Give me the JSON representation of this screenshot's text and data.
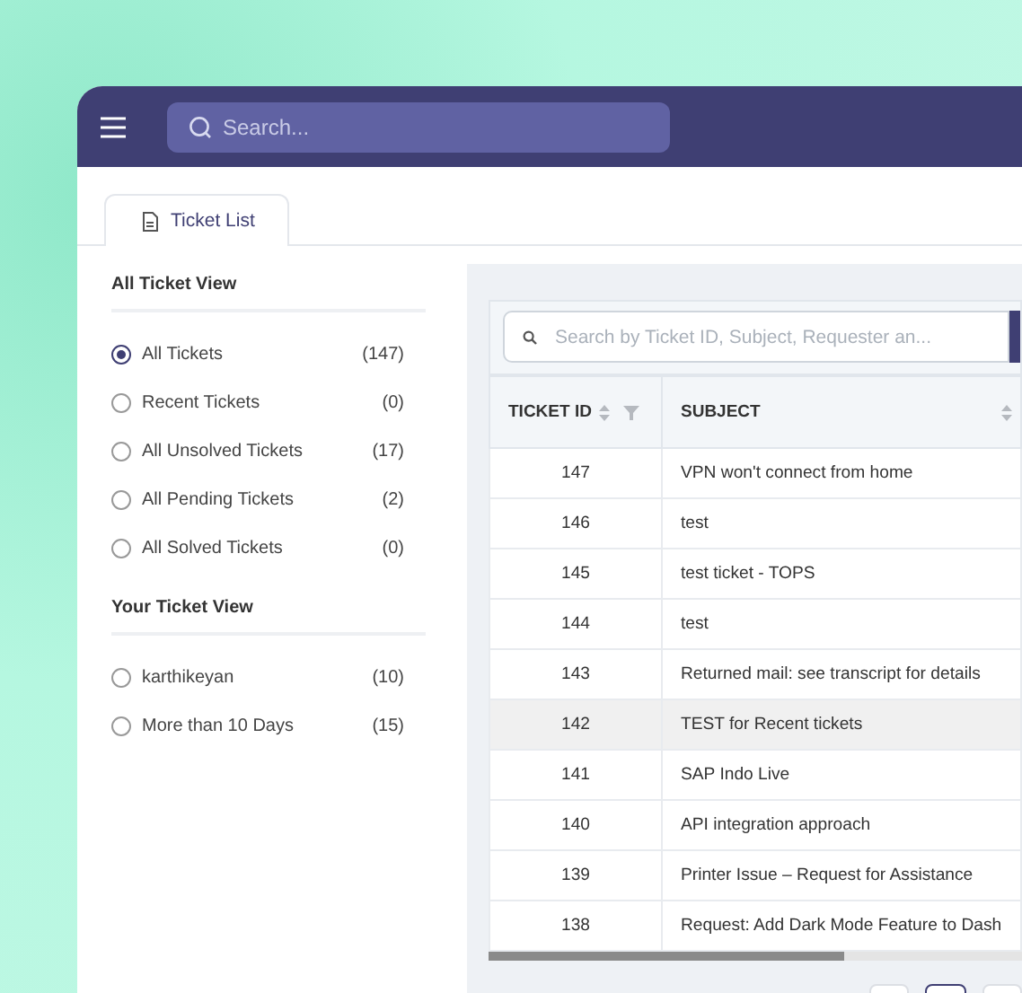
{
  "header": {
    "search": {
      "placeholder": "Search..."
    }
  },
  "tabs": [
    {
      "label": "Ticket List",
      "selected": true
    }
  ],
  "sidebar": {
    "sections": [
      {
        "title": "All Ticket View",
        "items": [
          {
            "label": "All Tickets",
            "count": "(147)",
            "selected": true
          },
          {
            "label": "Recent Tickets",
            "count": "(0)",
            "selected": false
          },
          {
            "label": "All Unsolved Tickets",
            "count": "(17)",
            "selected": false
          },
          {
            "label": "All Pending Tickets",
            "count": "(2)",
            "selected": false
          },
          {
            "label": "All Solved Tickets",
            "count": "(0)",
            "selected": false
          }
        ]
      },
      {
        "title": "Your Ticket View",
        "items": [
          {
            "label": "karthikeyan",
            "count": "(10)",
            "selected": false
          },
          {
            "label": "More than 10 Days",
            "count": "(15)",
            "selected": false
          }
        ]
      }
    ]
  },
  "table": {
    "search": {
      "placeholder": "Search by Ticket ID, Subject, Requester an..."
    },
    "columns": [
      {
        "label": "TICKET ID",
        "filter": true
      },
      {
        "label": "SUBJECT",
        "filter": false
      }
    ],
    "rows": [
      {
        "id": "147",
        "subject": "VPN won't connect from home",
        "selected": false
      },
      {
        "id": "146",
        "subject": "test",
        "selected": false
      },
      {
        "id": "145",
        "subject": "test ticket - TOPS",
        "selected": false
      },
      {
        "id": "144",
        "subject": "test",
        "selected": false
      },
      {
        "id": "143",
        "subject": "Returned mail: see transcript for details",
        "selected": false
      },
      {
        "id": "142",
        "subject": "TEST for Recent tickets",
        "selected": true
      },
      {
        "id": "141",
        "subject": "SAP Indo Live",
        "selected": false
      },
      {
        "id": "140",
        "subject": "API integration approach",
        "selected": false
      },
      {
        "id": "139",
        "subject": "Printer Issue – Request for Assistance",
        "selected": false
      },
      {
        "id": "138",
        "subject": "Request: Add Dark Mode Feature to Dash",
        "selected": false
      }
    ]
  },
  "pagination": [
    {
      "selected": false
    },
    {
      "selected": true
    },
    {
      "selected": false
    }
  ]
}
